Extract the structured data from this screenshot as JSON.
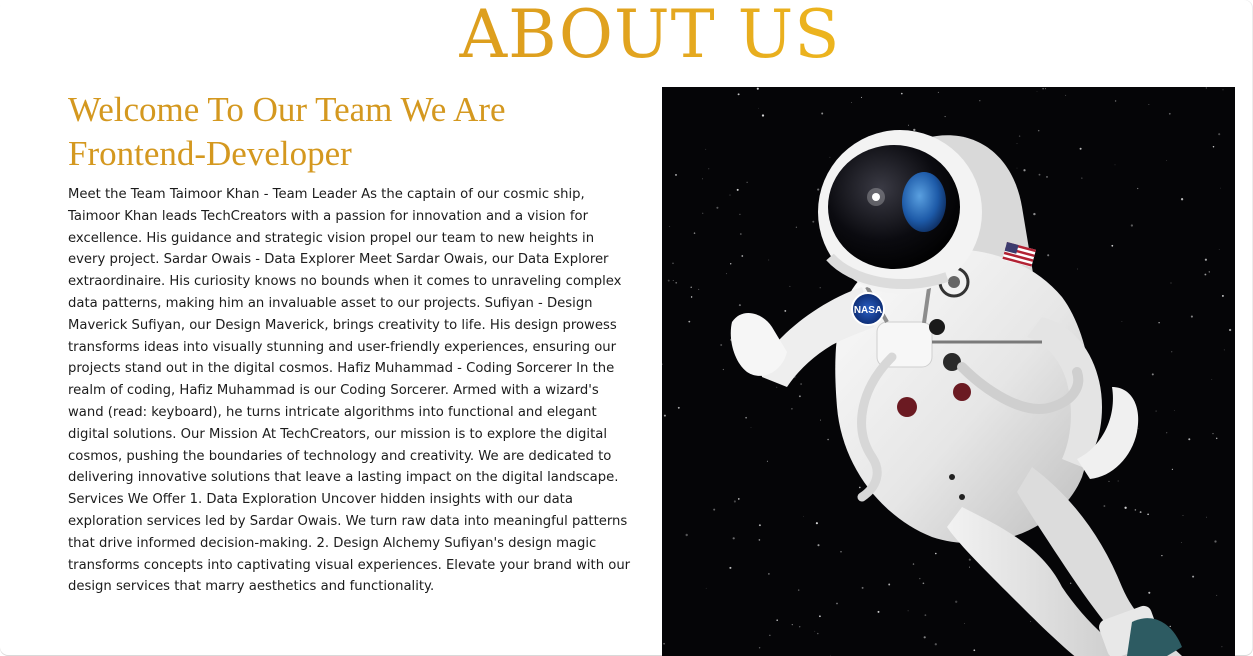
{
  "about": {
    "title": "ABOUT US",
    "heading": "Welcome To Our Team We Are Frontend-Developer",
    "body": "Meet the Team Taimoor Khan - Team Leader As the captain of our cosmic ship, Taimoor Khan leads TechCreators with a passion for innovation and a vision for excellence. His guidance and strategic vision propel our team to new heights in every project. Sardar Owais - Data Explorer Meet Sardar Owais, our Data Explorer extraordinaire. His curiosity knows no bounds when it comes to unraveling complex data patterns, making him an invaluable asset to our projects. Sufiyan - Design Maverick Sufiyan, our Design Maverick, brings creativity to life. His design prowess transforms ideas into visually stunning and user-friendly experiences, ensuring our projects stand out in the digital cosmos. Hafiz Muhammad - Coding Sorcerer In the realm of coding, Hafiz Muhammad is our Coding Sorcerer. Armed with a wizard's wand (read: keyboard), he turns intricate algorithms into functional and elegant digital solutions. Our Mission At TechCreators, our mission is to explore the digital cosmos, pushing the boundaries of technology and creativity. We are dedicated to delivering innovative solutions that leave a lasting impact on the digital landscape. Services We Offer 1. Data Exploration Uncover hidden insights with our data exploration services led by Sardar Owais. We turn raw data into meaningful patterns that drive informed decision-making. 2. Design Alchemy Sufiyan's design magic transforms concepts into captivating visual experiences. Elevate your brand with our design services that marry aesthetics and functionality.",
    "image": {
      "subject": "astronaut-floating-in-space",
      "patch_text": "NASA"
    }
  },
  "colors": {
    "title_gradient_start": "#d59a18",
    "title_gradient_end": "#ffd22a",
    "heading": "#d4981f",
    "body_text": "#1c1c1c",
    "image_background": "#050507"
  }
}
